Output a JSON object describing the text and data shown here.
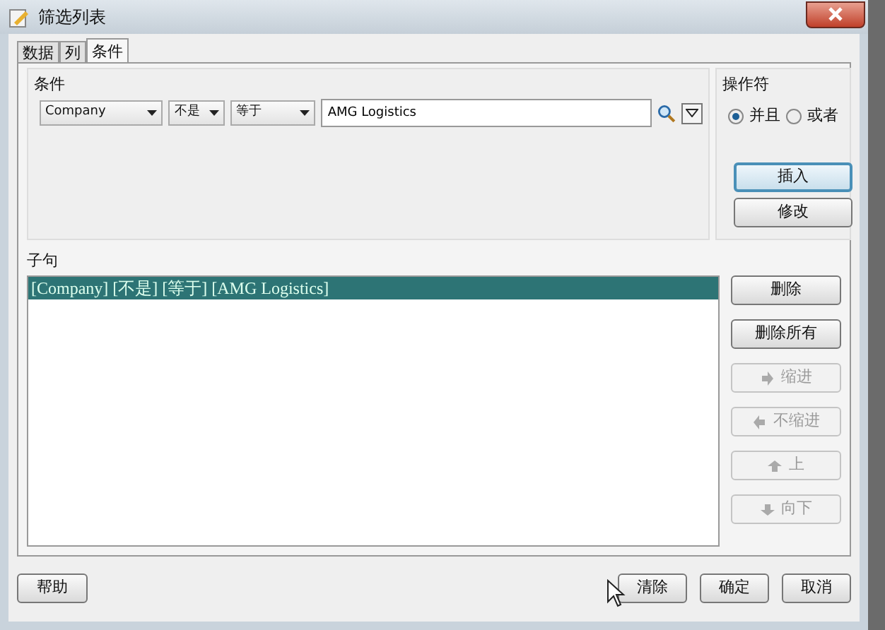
{
  "window": {
    "title": "筛选列表"
  },
  "tabs": [
    {
      "label": "数据",
      "selected": false
    },
    {
      "label": "列",
      "selected": false
    },
    {
      "label": "条件",
      "selected": true
    }
  ],
  "condition": {
    "label": "条件",
    "dropdowns": [
      {
        "value": "Company"
      },
      {
        "value": "不是"
      },
      {
        "value": "等于"
      }
    ],
    "value": "AMG Logistics"
  },
  "operator": {
    "label": "操作符",
    "options": [
      {
        "label": "并且",
        "selected": true
      },
      {
        "label": "或者",
        "selected": false
      }
    ],
    "buttons": [
      {
        "label": "插入",
        "focused": true
      },
      {
        "label": "修改",
        "focused": false
      }
    ]
  },
  "clauses": {
    "label": "子句",
    "rows": [
      {
        "text": "[Company] [不是] [等于] [AMG Logistics]",
        "selected": true
      }
    ]
  },
  "clause_buttons": [
    {
      "label": "删除",
      "disabled": false
    },
    {
      "label": "删除所有",
      "disabled": false
    },
    {
      "label": "缩进",
      "disabled": true,
      "kind": "right"
    },
    {
      "label": "不缩进",
      "disabled": true,
      "kind": "left"
    },
    {
      "label": "上",
      "disabled": true,
      "kind": "up"
    },
    {
      "label": "向下",
      "disabled": true,
      "kind": "down"
    }
  ],
  "footer": {
    "help": "帮助",
    "buttons": [
      "清除",
      "确定",
      "取消"
    ]
  }
}
